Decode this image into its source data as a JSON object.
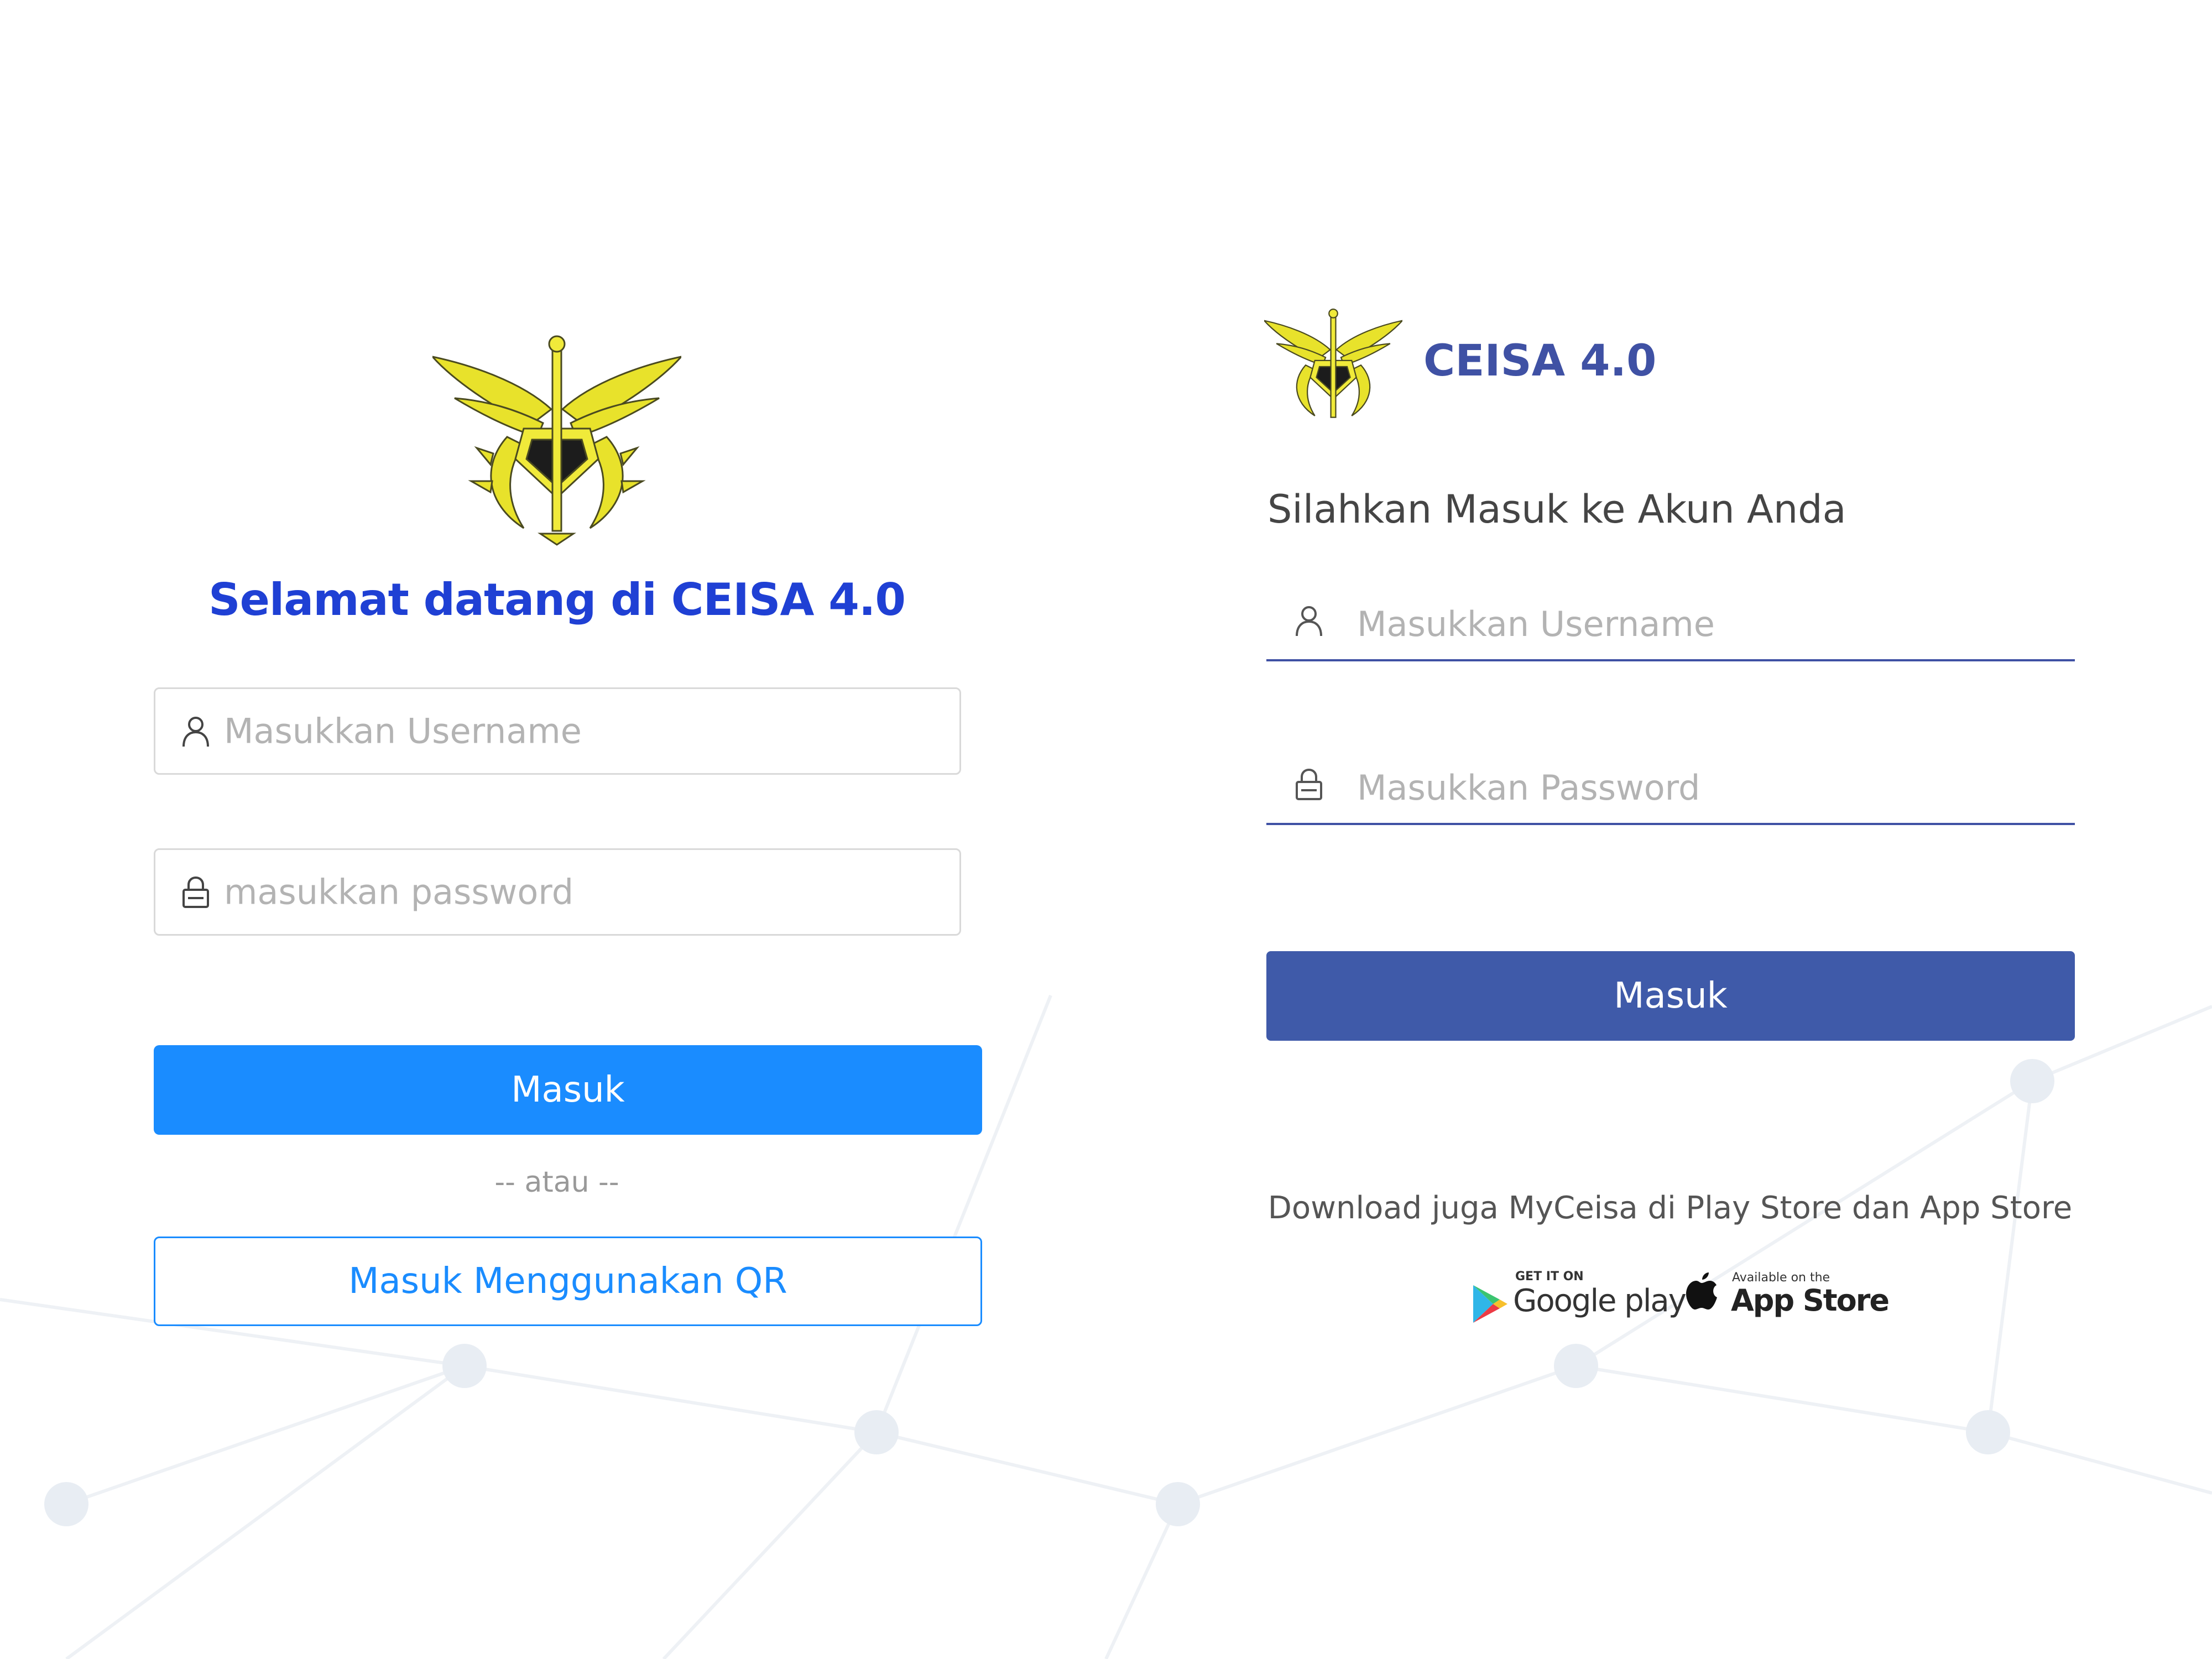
{
  "theme": {
    "left_accent": "#1f40d4",
    "left_button": "#1a8cff",
    "right_accent": "#3f51a4",
    "right_button": "#3f5aa9",
    "emblem_color": "#e8e22b",
    "placeholder": "#b3b3b3"
  },
  "left": {
    "title": "Selamat datang di CEISA 4.0",
    "username": {
      "icon": "user-icon",
      "placeholder": "Masukkan Username"
    },
    "password": {
      "icon": "lock-icon",
      "placeholder": "masukkan password"
    },
    "login_button": "Masuk",
    "divider": "-- atau --",
    "qr_button": "Masuk Menggunakan QR"
  },
  "right": {
    "app_name": "CEISA 4.0",
    "heading": "Silahkan Masuk ke Akun Anda",
    "username": {
      "icon": "user-icon",
      "placeholder": "Masukkan Username"
    },
    "password": {
      "icon": "lock-icon",
      "placeholder": "Masukkan Password"
    },
    "login_button": "Masuk",
    "download_text": "Download juga MyCeisa di Play Store dan App Store",
    "google_play": {
      "small": "GET IT ON",
      "big": "Google play"
    },
    "app_store": {
      "small": "Available on the",
      "big": "App Store"
    }
  }
}
